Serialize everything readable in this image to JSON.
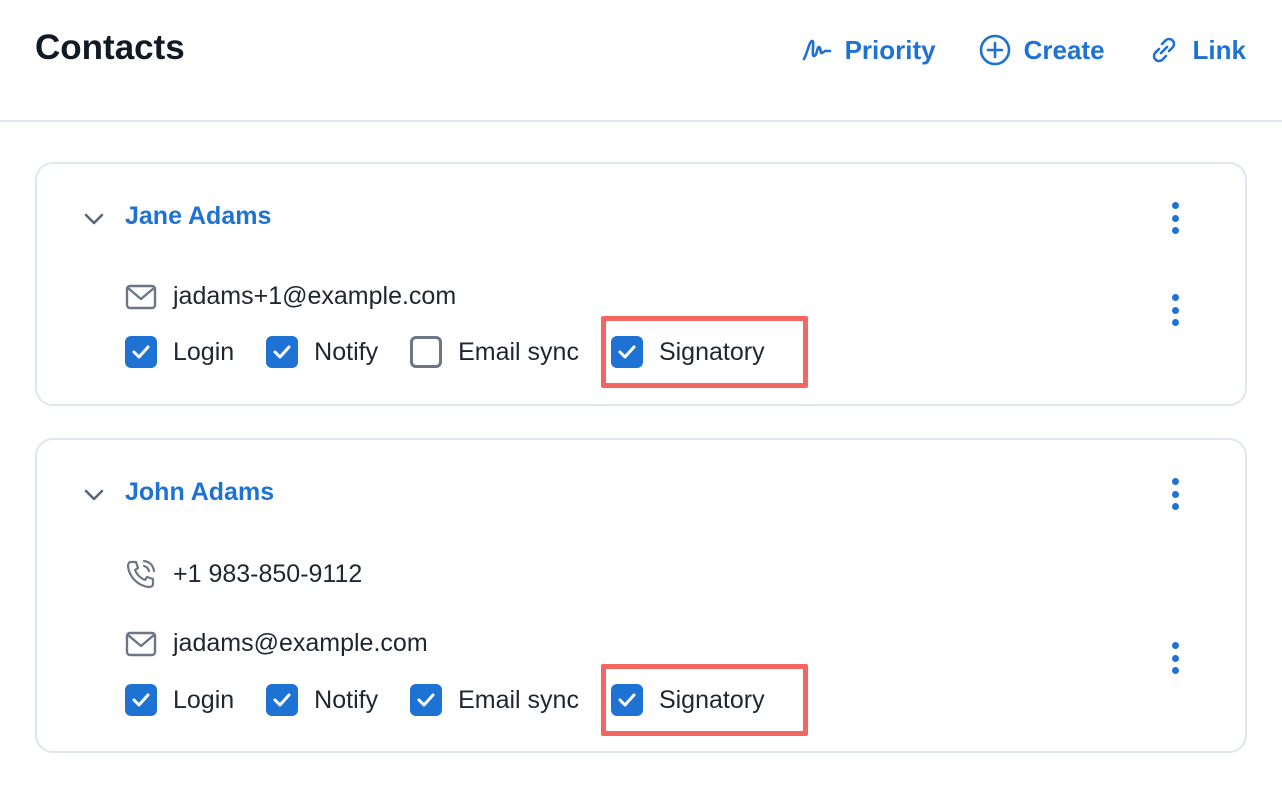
{
  "header": {
    "title": "Contacts",
    "actions": [
      {
        "label": "Priority",
        "icon": "signature-icon"
      },
      {
        "label": "Create",
        "icon": "plus-circle-icon"
      },
      {
        "label": "Link",
        "icon": "link-icon"
      }
    ]
  },
  "contacts": [
    {
      "name": "Jane Adams",
      "email": "jadams+1@example.com",
      "checks": [
        {
          "label": "Login",
          "checked": true
        },
        {
          "label": "Notify",
          "checked": true
        },
        {
          "label": "Email sync",
          "checked": false
        },
        {
          "label": "Signatory",
          "checked": true
        }
      ]
    },
    {
      "name": "John Adams",
      "phone": "+1 983-850-9112",
      "email": "jadams@example.com",
      "checks": [
        {
          "label": "Login",
          "checked": true
        },
        {
          "label": "Notify",
          "checked": true
        },
        {
          "label": "Email sync",
          "checked": true
        },
        {
          "label": "Signatory",
          "checked": true
        }
      ]
    }
  ],
  "colors": {
    "accent": "#1e72d4",
    "highlight": "#f56561",
    "border": "#e1e6ee"
  }
}
